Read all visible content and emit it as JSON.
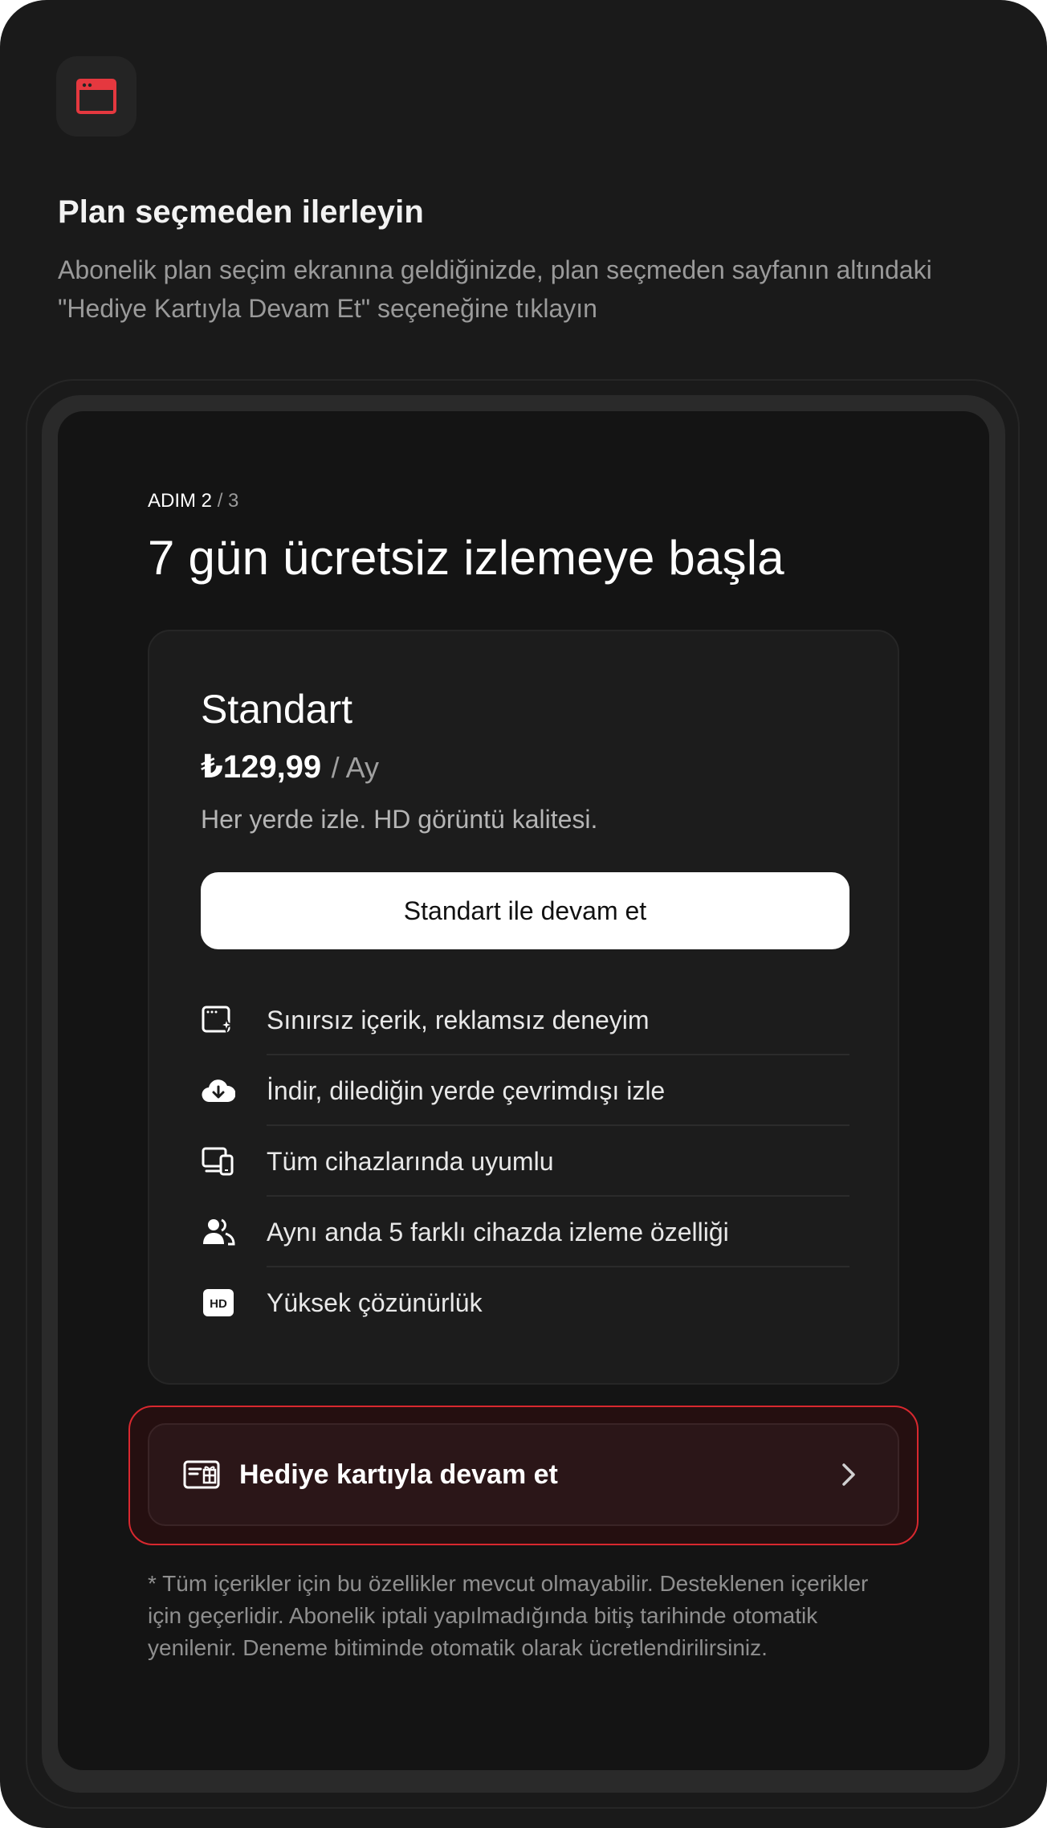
{
  "intro": {
    "heading": "Plan seçmeden ilerleyin",
    "description": "Abonelik plan seçim ekranına geldiğinizde, plan seçmeden sayfanın altındaki \"Hediye Kartıyla Devam Et\" seçeneğine tıklayın"
  },
  "screen": {
    "step_label": "ADIM 2",
    "step_total": "/ 3",
    "title": "7 gün ücretsiz izlemeye başla",
    "plan": {
      "name": "Standart",
      "price": "₺129,99",
      "period": "/ Ay",
      "description": "Her yerde izle. HD görüntü kalitesi.",
      "cta_label": "Standart ile devam et",
      "features": [
        {
          "icon": "ad-free-icon",
          "label": "Sınırsız içerik, reklamsız deneyim"
        },
        {
          "icon": "download-cloud-icon",
          "label": "İndir, dilediğin yerde çevrimdışı izle"
        },
        {
          "icon": "devices-icon",
          "label": "Tüm cihazlarında uyumlu"
        },
        {
          "icon": "users-icon",
          "label": "Aynı anda 5 farklı cihazda izleme özelliği"
        },
        {
          "icon": "hd-icon",
          "label": "Yüksek çözünürlük",
          "badge": "HD"
        }
      ]
    },
    "gift": {
      "label": "Hediye kartıyla devam et",
      "icon": "gift-card-icon"
    },
    "footnote": "* Tüm içerikler için bu özellikler mevcut olmayabilir. Desteklenen içerikler için geçerlidir. Abonelik iptali yapılmadığında bitiş tarihinde otomatik yenilenir. Deneme bitiminde otomatik olarak ücretlendirilirsiniz."
  },
  "colors": {
    "background": "#1a1a1a",
    "accent": "#d9282f",
    "cta_background": "#ffffff"
  }
}
